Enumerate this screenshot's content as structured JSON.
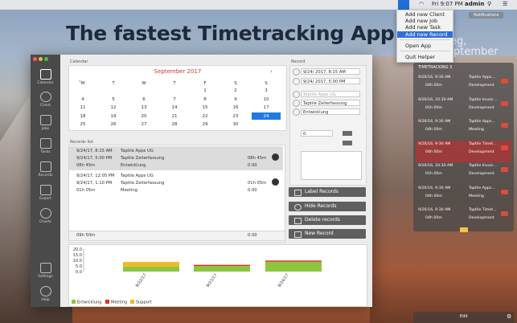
{
  "menubar": {
    "time": "Fri 9:07 PM",
    "user": "admin"
  },
  "status_menu": {
    "items": [
      "Add new Client",
      "Add new Job",
      "Add new Task",
      "Add new Record",
      "Open App",
      "Quit Helper"
    ],
    "selected_index": 3
  },
  "headline": "The fastest Timetracking App",
  "background_fragments": {
    "day": "eg,",
    "month": "eptember",
    "notifications": "Notifications"
  },
  "sidebar": {
    "items": [
      "Calendar",
      "Client",
      "Jobs",
      "Tasks",
      "Records",
      "Export",
      "Charts",
      "Settings",
      "Help"
    ],
    "active": "Calendar"
  },
  "calendar": {
    "section_label": "Calendar",
    "month": "September 2017",
    "weekdays": [
      "M",
      "T",
      "W",
      "T",
      "F",
      "S",
      "S"
    ],
    "rows": [
      [
        "",
        "",
        "",
        "",
        "1",
        "2",
        "3"
      ],
      [
        "4",
        "5",
        "6",
        "7",
        "8",
        "9",
        "10"
      ],
      [
        "11",
        "12",
        "13",
        "14",
        "15",
        "16",
        "17"
      ],
      [
        "18",
        "19",
        "20",
        "21",
        "22",
        "23",
        "24"
      ],
      [
        "25",
        "26",
        "27",
        "28",
        "29",
        "30",
        ""
      ]
    ],
    "selected_day": "24"
  },
  "records_list": {
    "section_label": "Records list",
    "records": [
      {
        "start": "9/24/17, 8:15 AM",
        "end": "9/24/17, 5:00 PM",
        "duration": "08h 45m",
        "client": "Taptile Apps UG",
        "job": "Taptile Zeiterfassung",
        "task": "Entwicklung",
        "time": "08h 45m",
        "extra": "0.00"
      },
      {
        "start": "9/24/17, 12:05 PM",
        "end": "9/24/17, 1:10 PM",
        "duration": "01h 05m",
        "client": "Taptile Apps UG",
        "job": "Taptile Zeiterfassung",
        "task": "Meeting",
        "time": "01h 05m",
        "extra": "0.00"
      }
    ],
    "total_time": "09h 50m",
    "total_extra": "0.00"
  },
  "record_form": {
    "section_label": "Record",
    "start": "9/24/ 2017,  8:15 AM",
    "end": "9/24/ 2017,  5:00 PM",
    "client_placeholder": "Taptile Apps UG",
    "job": "Taptile Zeiterfassung",
    "task": "Entwicklung",
    "value": "0"
  },
  "actions": {
    "label": "Label Records",
    "hide": "Hide Records",
    "delete": "Delete records",
    "new": "New Record"
  },
  "chart_data": {
    "type": "bar",
    "categories": [
      "9/22/17",
      "9/23/17",
      "9/24/17"
    ],
    "yticks": [
      "20.0",
      "15.0",
      "10.0",
      "5.0",
      "0.0"
    ],
    "ylim": [
      0,
      20
    ],
    "series": [
      {
        "name": "Entwicklung",
        "color": "#8cc63f",
        "values": [
          4.5,
          5.0,
          8.75
        ]
      },
      {
        "name": "Meeting",
        "color": "#d9302a",
        "values": [
          0,
          1.0,
          1.08
        ]
      },
      {
        "name": "Support",
        "color": "#f5b820",
        "values": [
          4.0,
          0,
          0
        ]
      }
    ]
  },
  "tray": {
    "title": "TIMETRACKING 3",
    "items": [
      {
        "date": "9/26/16, 9:30 AM",
        "dur": "04h 00m",
        "client": "Taptile Apps...",
        "task": "Development",
        "red": false
      },
      {
        "date": "9/26/16, 10:30 AM",
        "dur": "01h 00m",
        "client": "Taptile Invoic...",
        "task": "Development",
        "red": false
      },
      {
        "date": "9/26/16, 9:30 AM",
        "dur": "04h 00m",
        "client": "Taptile Apps...",
        "task": "Meeting",
        "red": false
      },
      {
        "date": "9/26/16, 9:30 AM",
        "dur": "04h 00m",
        "client": "Taptile Timet...",
        "task": "Development",
        "red": true
      },
      {
        "date": "9/26/16, 10:30 AM",
        "dur": "01h 00m",
        "client": "Taptile Invoic...",
        "task": "Development",
        "red": false
      },
      {
        "date": "9/26/16, 9:30 AM",
        "dur": "04h 00m",
        "client": "Taptile Apps...",
        "task": "Meeting",
        "red": false
      },
      {
        "date": "9/26/16, 9:30 AM",
        "dur": "04h 00m",
        "client": "Taptile Timet...",
        "task": "Development",
        "red": false
      }
    ],
    "edit_label": "Edit"
  }
}
